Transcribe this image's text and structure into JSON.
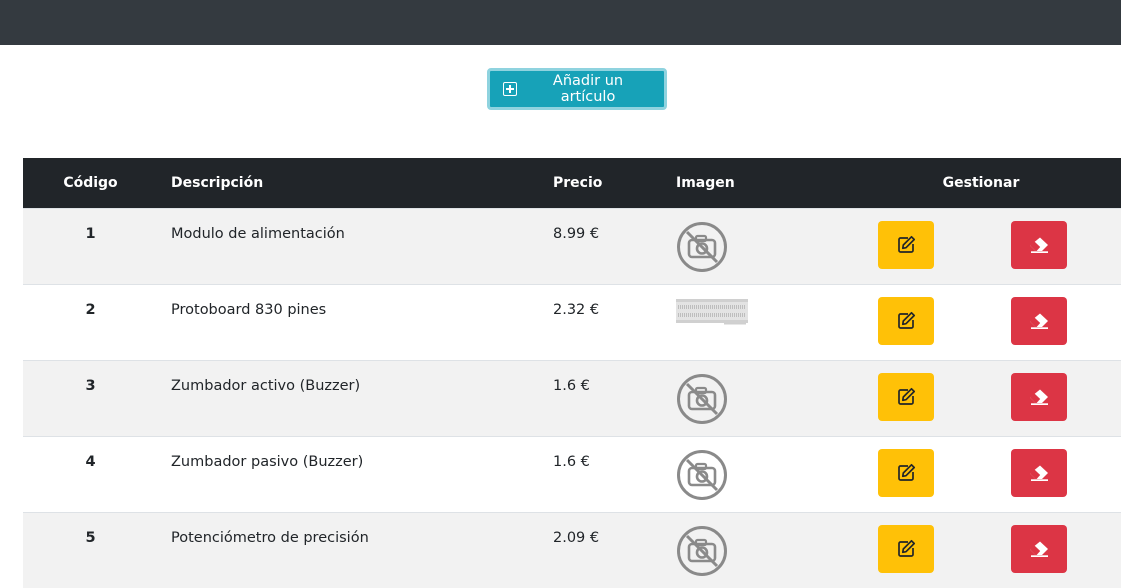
{
  "add_button": {
    "label": "Añadir un artículo",
    "icon": "plus-square-icon"
  },
  "table": {
    "headers": {
      "code": "Código",
      "description": "Descripción",
      "price": "Precio",
      "image": "Imagen",
      "manage": "Gestionar"
    },
    "rows": [
      {
        "code": "1",
        "description": "Modulo de alimentación",
        "price": "8.99 €",
        "image": "no-image-icon"
      },
      {
        "code": "2",
        "description": "Protoboard 830 pines",
        "price": "2.32 €",
        "image": "breadboard-thumbnail"
      },
      {
        "code": "3",
        "description": "Zumbador activo (Buzzer)",
        "price": "1.6 €",
        "image": "no-image-icon"
      },
      {
        "code": "4",
        "description": "Zumbador pasivo (Buzzer)",
        "price": "1.6 €",
        "image": "no-image-icon"
      },
      {
        "code": "5",
        "description": "Potenciómetro de precisión",
        "price": "2.09 €",
        "image": "no-image-icon"
      }
    ]
  },
  "colors": {
    "navbar": "#343a40",
    "add_button": "#17a2b8",
    "table_header": "#212529",
    "edit": "#ffc107",
    "delete": "#dc3545"
  }
}
